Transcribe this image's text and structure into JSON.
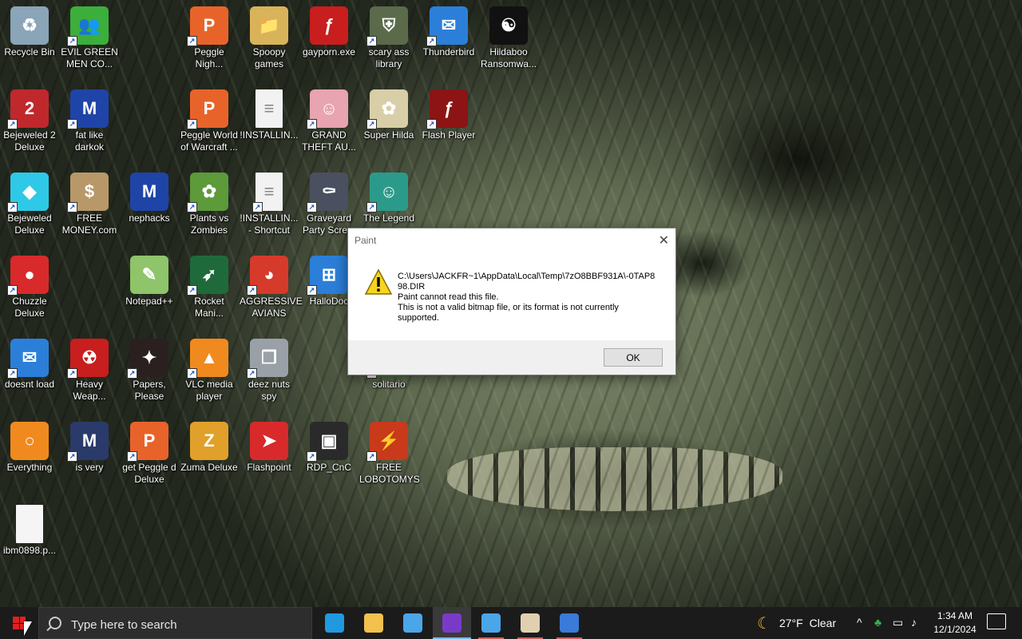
{
  "desktop": {
    "icons": [
      {
        "label": "Recycle Bin",
        "icon": "recycle-bin-icon",
        "color": "#8aa4b8",
        "glyph": "♻",
        "shortcut": false
      },
      {
        "label": "EVIL GREEN MEN CO...",
        "icon": "green-men-icon",
        "color": "#3cae3c",
        "glyph": "👥",
        "shortcut": true
      },
      {
        "label": "Peggle Nigh...",
        "icon": "peggle-icon",
        "color": "#e8632a",
        "glyph": "P",
        "shortcut": true
      },
      {
        "label": "Spoopy games",
        "icon": "folder-icon",
        "color": "#d9b35a",
        "glyph": "📁",
        "shortcut": false
      },
      {
        "label": "gayporn.exe",
        "icon": "flash-icon",
        "color": "#c81e1e",
        "glyph": "ƒ",
        "shortcut": false
      },
      {
        "label": "scary ass library",
        "icon": "library-icon",
        "color": "#5a6a4a",
        "glyph": "⛨",
        "shortcut": true
      },
      {
        "label": "Thunderbird",
        "icon": "thunderbird-icon",
        "color": "#2b7fd9",
        "glyph": "✉",
        "shortcut": true
      },
      {
        "label": "Hildaboo Ransomwa...",
        "icon": "ransomware-icon",
        "color": "#111111",
        "glyph": "☯",
        "shortcut": false
      },
      {
        "label": "Bejeweled 2 Deluxe",
        "icon": "bejeweled2-icon",
        "color": "#c0282c",
        "glyph": "2",
        "shortcut": true
      },
      {
        "label": "fat like darkok",
        "icon": "mpi-icon",
        "color": "#1e44a8",
        "glyph": "M",
        "shortcut": true
      },
      {
        "label": "Peggle World of Warcraft ...",
        "icon": "peggle-icon",
        "color": "#e8632a",
        "glyph": "P",
        "shortcut": true
      },
      {
        "label": "!INSTALLIN...",
        "icon": "text-file-icon",
        "color": "#f2f2f2",
        "glyph": "≡",
        "shortcut": false
      },
      {
        "label": "GRAND THEFT AU...",
        "icon": "anime-girl-icon",
        "color": "#e8a4b0",
        "glyph": "☺",
        "shortcut": true
      },
      {
        "label": "Super Hilda",
        "icon": "hilda-icon",
        "color": "#d8cfa8",
        "glyph": "✿",
        "shortcut": true
      },
      {
        "label": "Flash Player",
        "icon": "flash-icon",
        "color": "#8c1414",
        "glyph": "ƒ",
        "shortcut": true
      },
      {
        "label": "Bejeweled Deluxe",
        "icon": "gem-icon",
        "color": "#2ec9e6",
        "glyph": "◆",
        "shortcut": true
      },
      {
        "label": "FREE MONEY.com",
        "icon": "money-bag-icon",
        "color": "#b89868",
        "glyph": "$",
        "shortcut": true
      },
      {
        "label": "nephacks",
        "icon": "mpi-icon",
        "color": "#1e44a8",
        "glyph": "M",
        "shortcut": false
      },
      {
        "label": "Plants vs Zombies",
        "icon": "flower-icon",
        "color": "#5c9a3a",
        "glyph": "✿",
        "shortcut": true
      },
      {
        "label": "!INSTALLIN... - Shortcut",
        "icon": "text-file-icon",
        "color": "#f2f2f2",
        "glyph": "≡",
        "shortcut": true
      },
      {
        "label": "Graveyard Party Scre...",
        "icon": "graveyard-icon",
        "color": "#4a5060",
        "glyph": "⚰",
        "shortcut": true
      },
      {
        "label": "The Legend",
        "icon": "legend-icon",
        "color": "#2c9a8a",
        "glyph": "☺",
        "shortcut": true
      },
      {
        "label": "Chuzzle Deluxe",
        "icon": "chuzzle-icon",
        "color": "#d82a2a",
        "glyph": "●",
        "shortcut": true
      },
      {
        "label": "Notepad++",
        "icon": "notepad-icon",
        "color": "#8fc46a",
        "glyph": "✎",
        "shortcut": false
      },
      {
        "label": "Rocket Mani...",
        "icon": "rocket-icon",
        "color": "#1f6a3a",
        "glyph": "➶",
        "shortcut": true
      },
      {
        "label": "AGGRESSIVE AVIANS",
        "icon": "angry-bird-icon",
        "color": "#d63a2a",
        "glyph": "◕",
        "shortcut": true
      },
      {
        "label": "HalloDoc",
        "icon": "windows-shield-icon",
        "color": "#2b7fd9",
        "glyph": "⊞",
        "shortcut": true
      },
      {
        "label": "doesnt load",
        "icon": "thunderbird-icon",
        "color": "#2b7fd9",
        "glyph": "✉",
        "shortcut": true
      },
      {
        "label": "Heavy Weap...",
        "icon": "radiation-icon",
        "color": "#c81e1e",
        "glyph": "☢",
        "shortcut": true
      },
      {
        "label": "Papers, Please",
        "icon": "papers-please-icon",
        "color": "#2a2020",
        "glyph": "✦",
        "shortcut": true
      },
      {
        "label": "VLC media player",
        "icon": "vlc-icon",
        "color": "#f08a1e",
        "glyph": "▲",
        "shortcut": true
      },
      {
        "label": "deez nuts spy",
        "icon": "windows-copy-icon",
        "color": "#9aa0a8",
        "glyph": "❐",
        "shortcut": true
      },
      {
        "label": "solitario",
        "icon": "solitaire-icon",
        "color": "#4a7a3a",
        "glyph": "♠",
        "shortcut": true
      },
      {
        "label": "Everything",
        "icon": "search-ring-icon",
        "color": "#f08a1e",
        "glyph": "○",
        "shortcut": false
      },
      {
        "label": "is very",
        "icon": "mpi-shield-icon",
        "color": "#2a3a6a",
        "glyph": "M",
        "shortcut": true
      },
      {
        "label": "get Peggle d Deluxe",
        "icon": "peggle-icon",
        "color": "#e8632a",
        "glyph": "P",
        "shortcut": true
      },
      {
        "label": "Zuma Deluxe",
        "icon": "zuma-icon",
        "color": "#e0a02a",
        "glyph": "Z",
        "shortcut": false
      },
      {
        "label": "Flashpoint",
        "icon": "flashpoint-icon",
        "color": "#d82a2a",
        "glyph": "➤",
        "shortcut": false
      },
      {
        "label": "RDP_CnC",
        "icon": "rdp-icon",
        "color": "#2a2a2a",
        "glyph": "▣",
        "shortcut": true
      },
      {
        "label": "FREE LOBOTOMYS",
        "icon": "lobotomy-icon",
        "color": "#c83a1a",
        "glyph": "⚡",
        "shortcut": true
      },
      {
        "label": "ibm0898.p...",
        "icon": "blank-file-icon",
        "color": "#f5f5f5",
        "glyph": "",
        "shortcut": false
      }
    ]
  },
  "dialog": {
    "title": "Paint",
    "path_line1": "C:\\Users\\JACKFR~1\\AppData\\Local\\Temp\\7zO8BBF931A\\-0TAP8",
    "path_line2": "98.DIR",
    "line3": "Paint cannot read this file.",
    "line4": "This is not a valid bitmap file, or its format is not currently",
    "line5": "supported.",
    "ok_label": "OK",
    "close_glyph": "✕"
  },
  "taskbar": {
    "search_placeholder": "Type here to search",
    "apps": [
      {
        "name": "edge",
        "color": "#1f9adf",
        "active": false
      },
      {
        "name": "file-explorer",
        "color": "#f2c14e",
        "active": false
      },
      {
        "name": "app-box",
        "color": "#4aa6e8",
        "active": false
      },
      {
        "name": "mask-app",
        "color": "#7a3ac8",
        "active": true
      },
      {
        "name": "app-box-2",
        "color": "#4aa6e8",
        "active": false
      },
      {
        "name": "paint",
        "color": "#e0d0b0",
        "active": false
      },
      {
        "name": "window-app",
        "color": "#3a7ad8",
        "active": false
      }
    ],
    "weather_icon": "☾",
    "temperature": "27°F",
    "weather_text": "Clear",
    "tray_chevron": "^",
    "time": "1:34 AM",
    "date": "12/1/2024"
  }
}
